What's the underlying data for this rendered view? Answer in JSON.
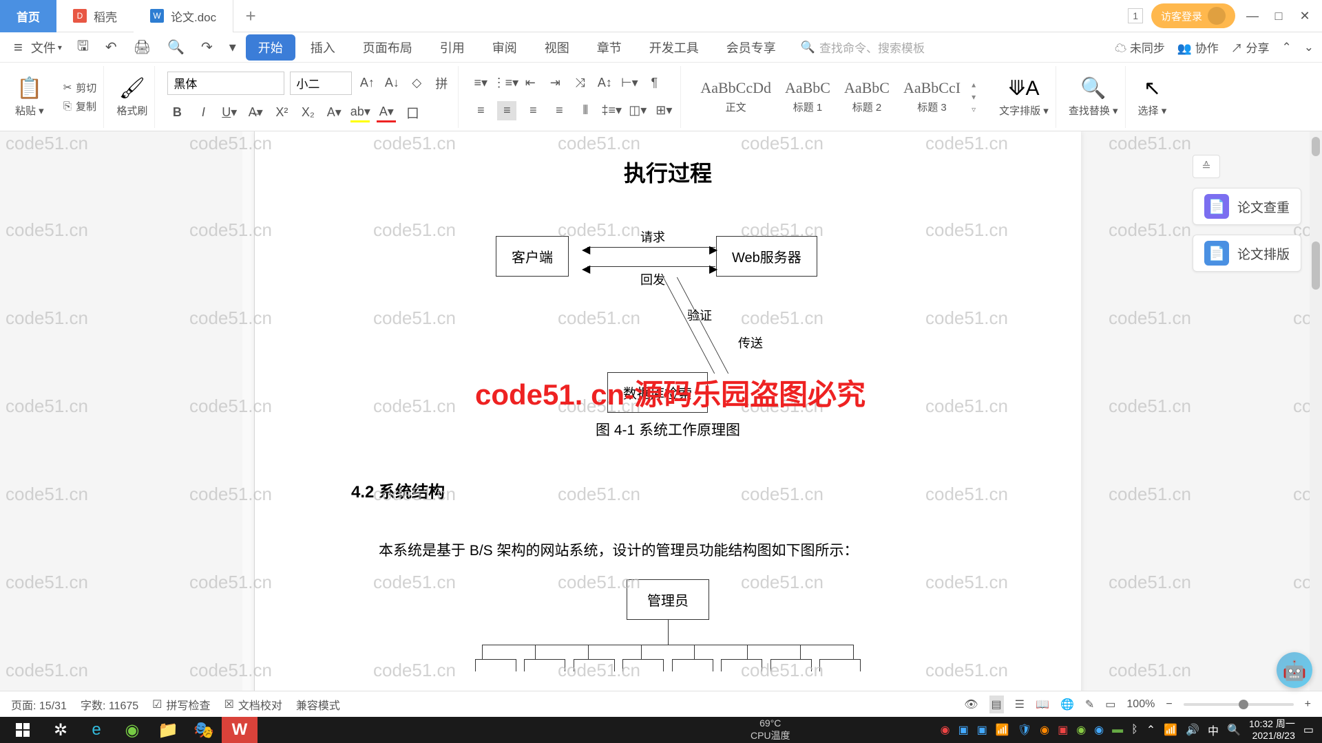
{
  "titlebar": {
    "tab_home": "首页",
    "tab_dk": "稻壳",
    "tab_doc": "论文.doc",
    "tab_add": "+",
    "badge_num": "1",
    "login": "访客登录"
  },
  "menubar": {
    "file": "文件",
    "items": [
      "开始",
      "插入",
      "页面布局",
      "引用",
      "审阅",
      "视图",
      "章节",
      "开发工具",
      "会员专享"
    ],
    "search_ph": "查找命令、搜索模板",
    "unsync": "未同步",
    "coop": "协作",
    "share": "分享"
  },
  "ribbon": {
    "paste": "粘贴",
    "cut": "剪切",
    "copy": "复制",
    "fmt": "格式刷",
    "font": "黑体",
    "size": "小二",
    "styles": [
      {
        "preview": "AaBbCcDd",
        "label": "正文"
      },
      {
        "preview": "AaBbC",
        "label": "标题 1"
      },
      {
        "preview": "AaBbC",
        "label": "标题 2"
      },
      {
        "preview": "AaBbCcI",
        "label": "标题 3"
      }
    ],
    "text_layout": "文字排版",
    "find_replace": "查找替换",
    "select": "选择"
  },
  "doc": {
    "title": "执行过程",
    "box_client": "客户端",
    "box_web": "Web服务器",
    "box_db": "数据库检索",
    "lbl_req": "请求",
    "lbl_resp": "回发",
    "lbl_verify": "验证",
    "lbl_send": "传送",
    "caption": "图 4-1 系统工作原理图",
    "section": "4.2 系统结构",
    "body": "本系统是基于 B/S 架构的网站系统，设计的管理员功能结构图如下图所示：",
    "box_admin": "管理员",
    "watermark": "code51.cn",
    "wm_red": "code51. cn-源码乐园盗图必究"
  },
  "side": {
    "check": "论文查重",
    "layout": "论文排版"
  },
  "status": {
    "page": "页面: 15/31",
    "words": "字数: 11675",
    "spell": "拼写检查",
    "docCheck": "文档校对",
    "compat": "兼容模式",
    "zoom": "100%"
  },
  "tray": {
    "cpu_temp": "69°C",
    "cpu_lbl": "CPU温度",
    "ime": "中",
    "time": "10:32 周一",
    "date": "2021/8/23"
  }
}
